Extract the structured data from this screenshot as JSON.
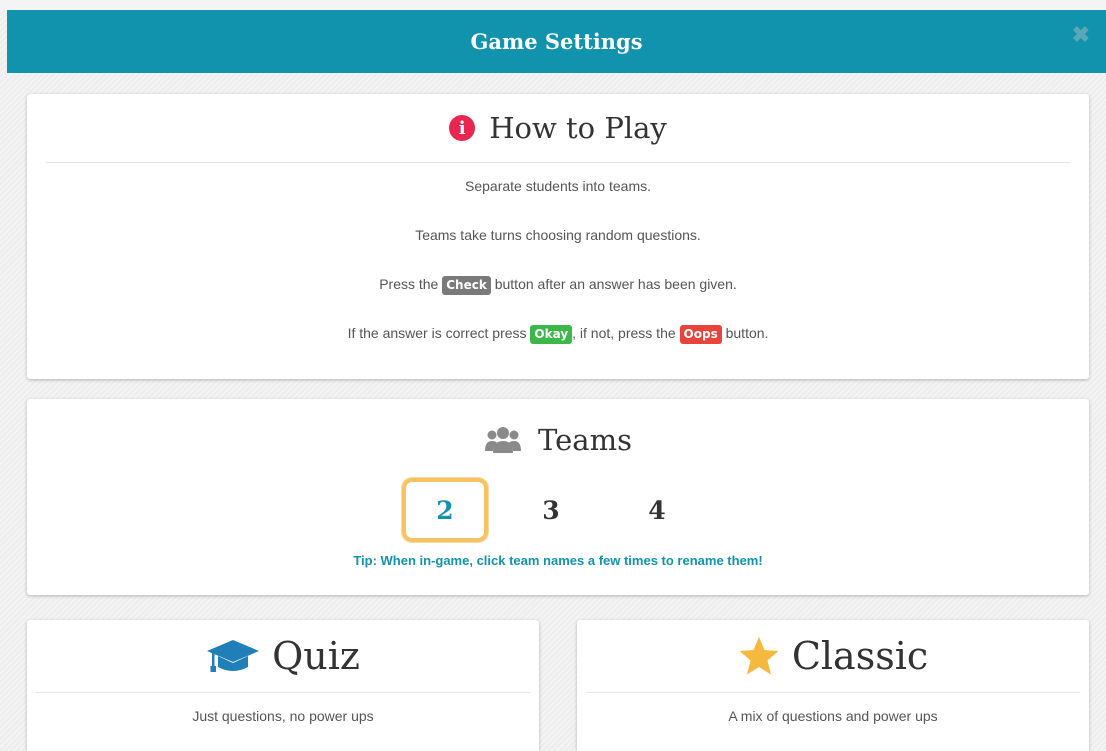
{
  "header": {
    "title": "Game Settings",
    "close": "✖"
  },
  "how_to_play": {
    "title": "How to Play",
    "lines": {
      "l1": "Separate students into teams.",
      "l2": "Teams take turns choosing random questions.",
      "l3_pre": "Press the ",
      "l3_tag": "Check",
      "l3_post": " button after an answer has been given.",
      "l4_pre": "If the answer is correct press ",
      "l4_tag1": "Okay",
      "l4_mid": ", if not, press the ",
      "l4_tag2": "Oops",
      "l4_post": " button."
    }
  },
  "teams": {
    "title": "Teams",
    "options": [
      "2",
      "3",
      "4"
    ],
    "selected": "2",
    "tip": "Tip: When in-game, click team names a few times to rename them!"
  },
  "modes": {
    "quiz": {
      "title": "Quiz",
      "desc": "Just questions, no power ups"
    },
    "classic": {
      "title": "Classic",
      "desc": "A mix of questions and power ups"
    }
  },
  "colors": {
    "accent": "#1193ad",
    "highlight": "#f8c262",
    "info": "#e8264f",
    "okay": "#3cb84a",
    "oops": "#e8443b"
  }
}
